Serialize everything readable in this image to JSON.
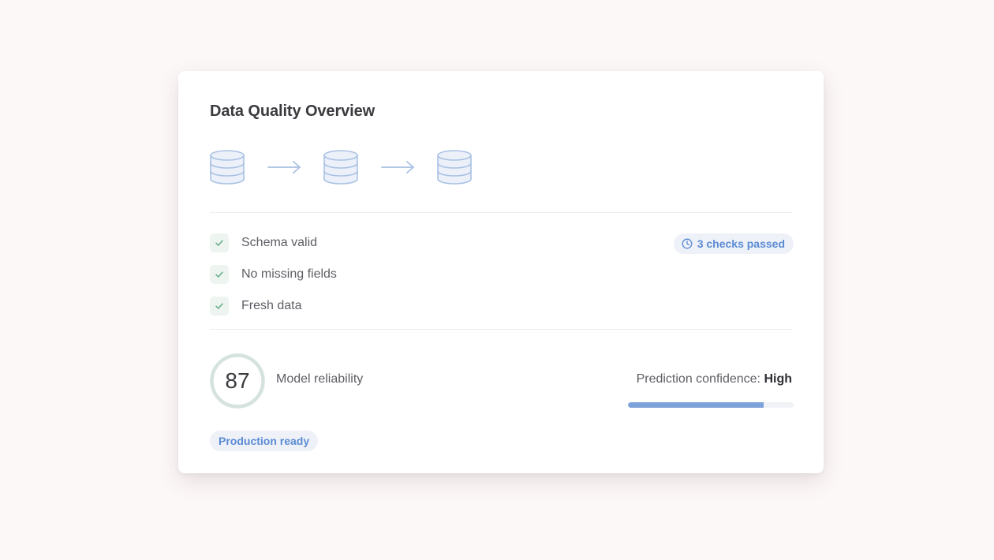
{
  "card": {
    "title": "Data Quality Overview"
  },
  "pipeline": {
    "icons": [
      "database-icon",
      "arrow-right-icon",
      "database-icon",
      "arrow-right-icon",
      "database-icon"
    ],
    "color": "#a9c1e3"
  },
  "checks": {
    "items": [
      {
        "label": "Schema valid",
        "icon": "check-icon"
      },
      {
        "label": "No missing fields",
        "icon": "check-icon"
      },
      {
        "label": "Fresh data",
        "icon": "check-icon"
      }
    ],
    "badge": {
      "label": "3 checks passed",
      "icon": "clock-icon"
    }
  },
  "metrics": {
    "score": "87",
    "score_label": "Model reliability",
    "confidence_label": "Prediction confidence:",
    "confidence_value": "High",
    "confidence_level": 0.82
  },
  "status": {
    "label": "Production ready"
  },
  "colors": {
    "accent": "#5b8bd3",
    "check": "#6bb08c",
    "ring": "#d5e2df",
    "bar": "#7ea3da"
  }
}
